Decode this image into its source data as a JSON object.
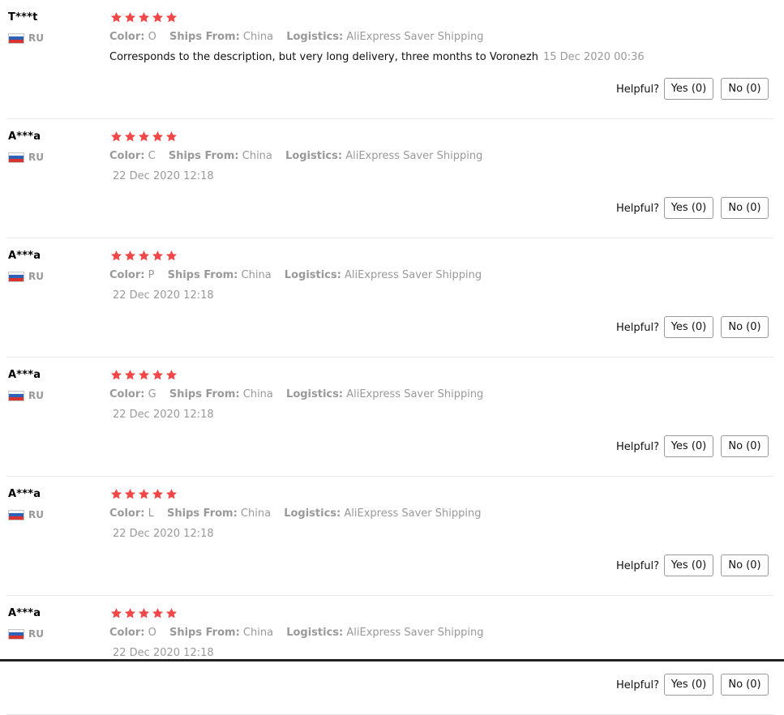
{
  "reviews": [
    {
      "user": "T***t",
      "country": "RU",
      "rating": 5,
      "color_label": "Color:",
      "color_value": "O",
      "ships_label": "Ships From:",
      "ships_value": "China",
      "logistics_label": "Logistics:",
      "logistics_value": "AliExpress Saver Shipping",
      "text": "Corresponds to the description, but very long delivery, three months to Voronezh",
      "date": "15 Dec 2020 00:36",
      "helpful_label": "Helpful?",
      "yes_label": "Yes (0)",
      "no_label": "No (0)"
    },
    {
      "user": "A***a",
      "country": "RU",
      "rating": 5,
      "color_label": "Color:",
      "color_value": "C",
      "ships_label": "Ships From:",
      "ships_value": "China",
      "logistics_label": "Logistics:",
      "logistics_value": "AliExpress Saver Shipping",
      "text": "",
      "date": "22 Dec 2020 12:18",
      "helpful_label": "Helpful?",
      "yes_label": "Yes (0)",
      "no_label": "No (0)"
    },
    {
      "user": "A***a",
      "country": "RU",
      "rating": 5,
      "color_label": "Color:",
      "color_value": "P",
      "ships_label": "Ships From:",
      "ships_value": "China",
      "logistics_label": "Logistics:",
      "logistics_value": "AliExpress Saver Shipping",
      "text": "",
      "date": "22 Dec 2020 12:18",
      "helpful_label": "Helpful?",
      "yes_label": "Yes (0)",
      "no_label": "No (0)"
    },
    {
      "user": "A***a",
      "country": "RU",
      "rating": 5,
      "color_label": "Color:",
      "color_value": "G",
      "ships_label": "Ships From:",
      "ships_value": "China",
      "logistics_label": "Logistics:",
      "logistics_value": "AliExpress Saver Shipping",
      "text": "",
      "date": "22 Dec 2020 12:18",
      "helpful_label": "Helpful?",
      "yes_label": "Yes (0)",
      "no_label": "No (0)"
    },
    {
      "user": "A***a",
      "country": "RU",
      "rating": 5,
      "color_label": "Color:",
      "color_value": "L",
      "ships_label": "Ships From:",
      "ships_value": "China",
      "logistics_label": "Logistics:",
      "logistics_value": "AliExpress Saver Shipping",
      "text": "",
      "date": "22 Dec 2020 12:18",
      "helpful_label": "Helpful?",
      "yes_label": "Yes (0)",
      "no_label": "No (0)"
    },
    {
      "user": "A***a",
      "country": "RU",
      "rating": 5,
      "color_label": "Color:",
      "color_value": "O",
      "ships_label": "Ships From:",
      "ships_value": "China",
      "logistics_label": "Logistics:",
      "logistics_value": "AliExpress Saver Shipping",
      "text": "",
      "date": "22 Dec 2020 12:18",
      "helpful_label": "Helpful?",
      "yes_label": "Yes (0)",
      "no_label": "No (0)"
    }
  ],
  "icons": {
    "star": "star-icon",
    "flag": "russia-flag-icon"
  },
  "colors": {
    "star": "#f04848",
    "muted_text": "#999999",
    "divider": "#e8e8e8"
  }
}
